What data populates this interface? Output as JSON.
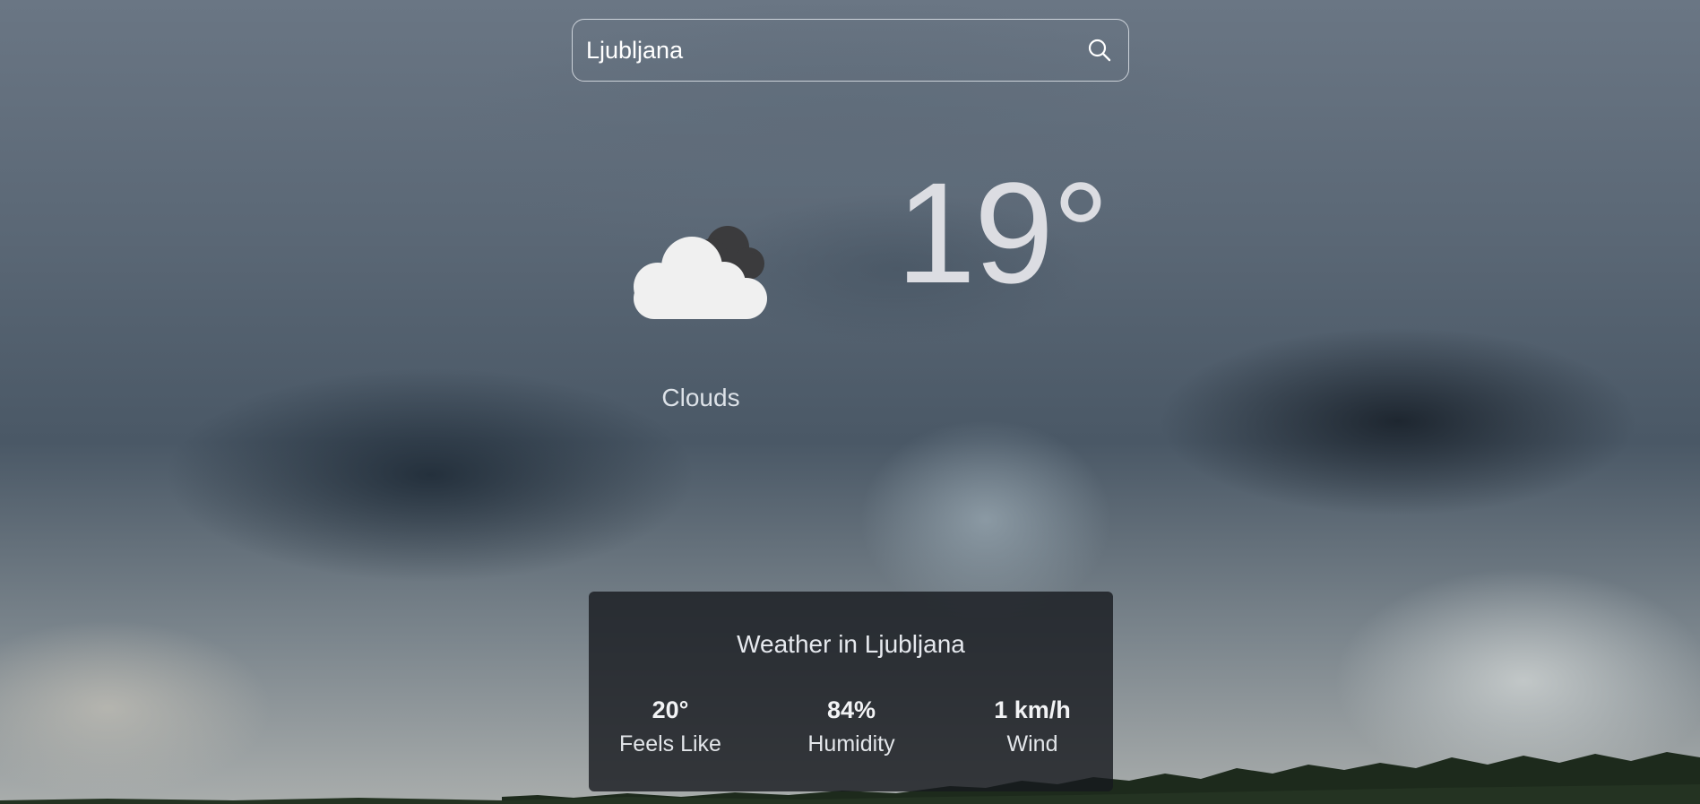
{
  "search": {
    "value": "Ljubljana",
    "icon": "search-icon"
  },
  "current": {
    "icon": "clouds-icon",
    "temperature": "19°",
    "condition": "Clouds"
  },
  "details": {
    "title": "Weather in Ljubljana",
    "stats": [
      {
        "value": "20°",
        "label": "Feels Like"
      },
      {
        "value": "84%",
        "label": "Humidity"
      },
      {
        "value": "1 km/h",
        "label": "Wind"
      }
    ]
  },
  "colors": {
    "text": "#ffffff",
    "card_background": "rgba(22,25,30,0.8)",
    "cloud_white": "#f0f0f0",
    "cloud_dark": "#3b3b3d"
  }
}
